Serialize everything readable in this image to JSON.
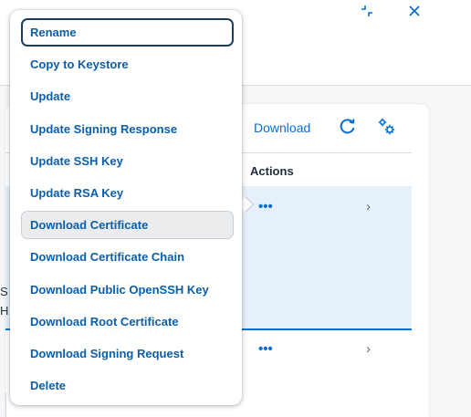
{
  "window": {
    "resize_icon": "exit-fullscreen-icon",
    "close_icon": "close-icon"
  },
  "toolbar": {
    "download_label": "Download",
    "refresh_icon": "refresh-icon",
    "settings_icon": "settings-icon"
  },
  "table": {
    "actions_header": "Actions",
    "rows": [
      {
        "more_label": "•••",
        "chevron": "›"
      },
      {
        "more_label": "•••",
        "chevron": "›"
      }
    ],
    "fragments": [
      "S",
      "H"
    ]
  },
  "context_menu": {
    "items": [
      {
        "label": "Rename",
        "state": "focused"
      },
      {
        "label": "Copy to Keystore",
        "state": ""
      },
      {
        "label": "Update",
        "state": ""
      },
      {
        "label": "Update Signing Response",
        "state": ""
      },
      {
        "label": "Update SSH Key",
        "state": ""
      },
      {
        "label": "Update RSA Key",
        "state": ""
      },
      {
        "label": "Download Certificate",
        "state": "hovered"
      },
      {
        "label": "Download Certificate Chain",
        "state": ""
      },
      {
        "label": "Download Public OpenSSH Key",
        "state": ""
      },
      {
        "label": "Download Root Certificate",
        "state": ""
      },
      {
        "label": "Download Signing Request",
        "state": ""
      },
      {
        "label": "Delete",
        "state": ""
      }
    ]
  },
  "colors": {
    "accent": "#0a6ed1",
    "menu_text": "#0b5ea8",
    "selected_row": "#e5f0fa"
  }
}
